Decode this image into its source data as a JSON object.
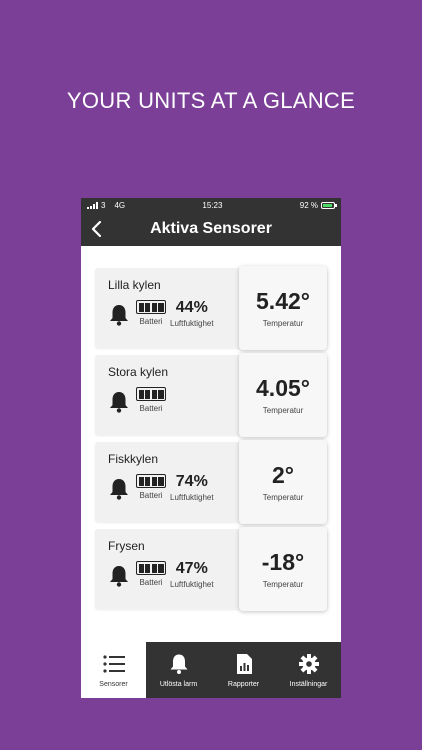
{
  "headline": "YOUR UNITS AT A GLANCE",
  "status": {
    "carrier": "3",
    "network": "4G",
    "time": "15:23",
    "battery": "92 %"
  },
  "nav": {
    "title": "Aktiva Sensorer"
  },
  "labels": {
    "battery": "Batteri",
    "humidity": "Luftfuktighet",
    "temperature": "Temperatur"
  },
  "sensors": [
    {
      "name": "Lilla kylen",
      "humidity": "44%",
      "temp": "5.42°"
    },
    {
      "name": "Stora kylen",
      "humidity": "",
      "temp": "4.05°"
    },
    {
      "name": "Fiskkylen",
      "humidity": "74%",
      "temp": "2°"
    },
    {
      "name": "Frysen",
      "humidity": "47%",
      "temp": "-18°"
    }
  ],
  "tabs": [
    {
      "label": "Sensorer",
      "icon": "list-icon"
    },
    {
      "label": "Utlösta larm",
      "icon": "bell-icon"
    },
    {
      "label": "Rapporter",
      "icon": "report-icon"
    },
    {
      "label": "Inställningar",
      "icon": "gear-icon"
    }
  ],
  "colors": {
    "background": "#7b3f98",
    "bar": "#333333",
    "battery_fill": "#4cd964"
  }
}
